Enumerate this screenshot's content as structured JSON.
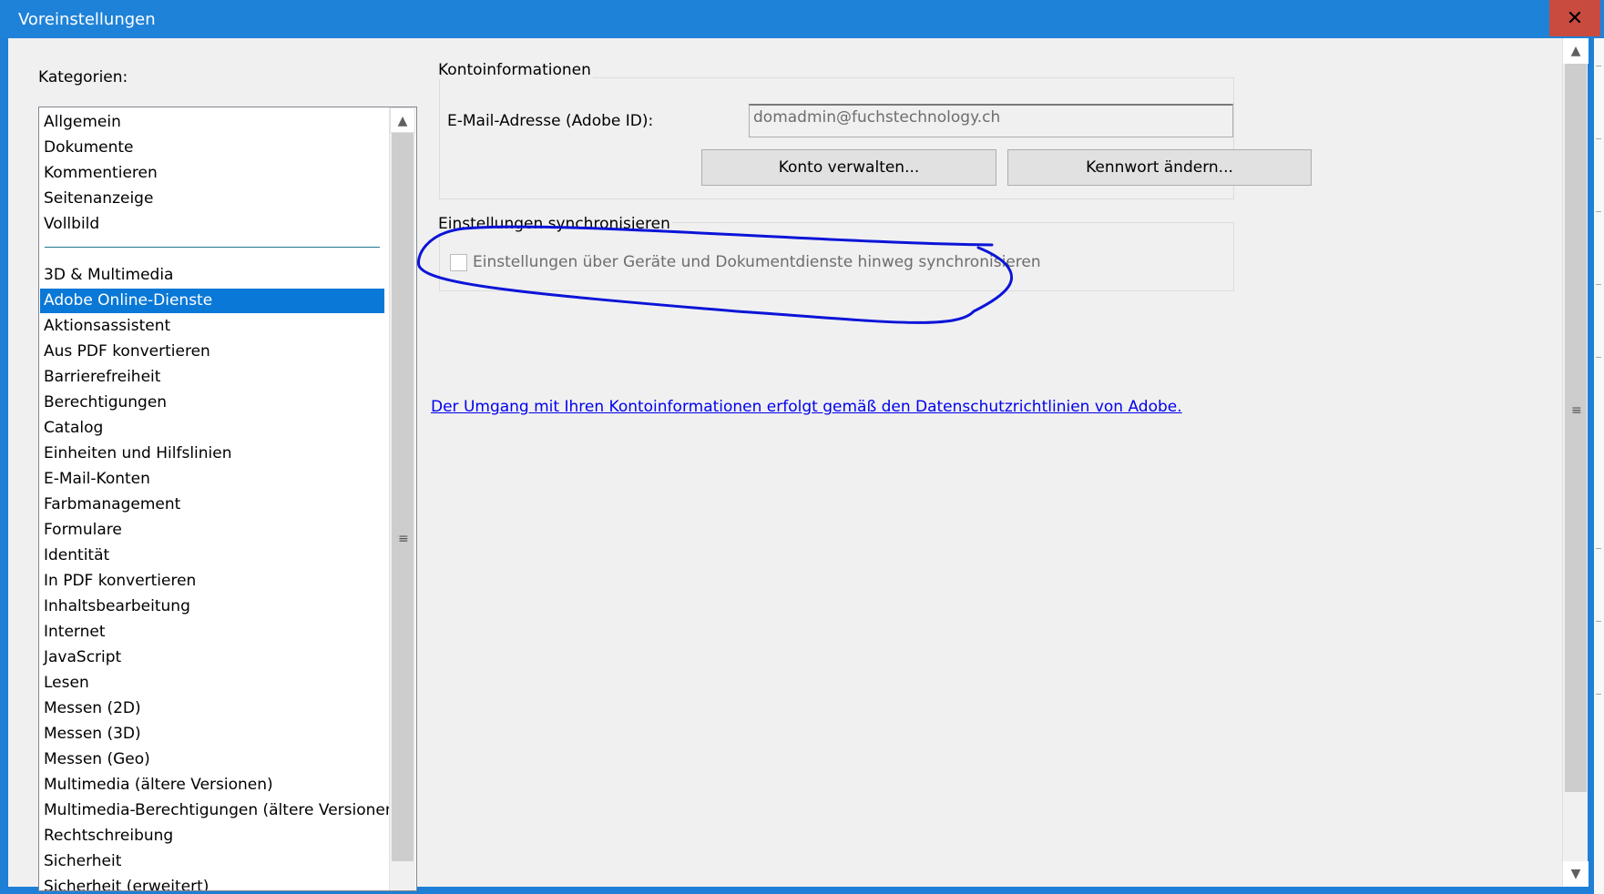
{
  "window": {
    "title": "Voreinstellungen",
    "close_glyph": "✕"
  },
  "sidebar": {
    "label": "Kategorien:",
    "items_top": [
      "Allgemein",
      "Dokumente",
      "Kommentieren",
      "Seitenanzeige",
      "Vollbild"
    ],
    "items_bottom": [
      "3D & Multimedia",
      "Adobe Online-Dienste",
      "Aktionsassistent",
      "Aus PDF konvertieren",
      "Barrierefreiheit",
      "Berechtigungen",
      "Catalog",
      "Einheiten und Hilfslinien",
      "E-Mail-Konten",
      "Farbmanagement",
      "Formulare",
      "Identität",
      "In PDF konvertieren",
      "Inhaltsbearbeitung",
      "Internet",
      "JavaScript",
      "Lesen",
      "Messen (2D)",
      "Messen (3D)",
      "Messen (Geo)",
      "Multimedia (ältere Versionen)",
      "Multimedia-Berechtigungen (ältere Versionen)",
      "Rechtschreibung",
      "Sicherheit",
      "Sicherheit (erweitert)"
    ],
    "selected": "Adobe Online-Dienste"
  },
  "account": {
    "group_title": "Kontoinformationen",
    "email_label": "E-Mail-Adresse (Adobe ID):",
    "email_value": "domadmin@fuchstechnology.ch",
    "manage_button": "Konto verwalten...",
    "password_button": "Kennwort ändern..."
  },
  "sync": {
    "group_title": "Einstellungen synchronisieren",
    "checkbox_label": "Einstellungen über Geräte und Dokumentdienste hinweg synchronisieren",
    "checked": false
  },
  "policy_link": "Der Umgang mit Ihren Kontoinformationen erfolgt gemäß den Datenschutzrichtlinien von Adobe.",
  "colors": {
    "titlebar": "#1e82d8",
    "selection": "#0a78d7",
    "annotation": "#0b14d8",
    "link": "#0000ee"
  }
}
